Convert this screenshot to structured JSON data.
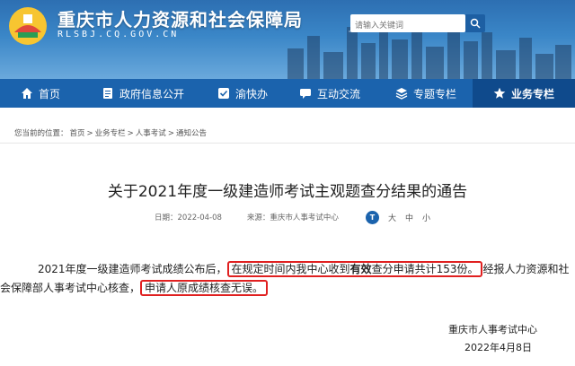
{
  "header": {
    "site_title": "重庆市人力资源和社会保障局",
    "site_domain": "RLSBJ.CQ.GOV.CN",
    "search_placeholder": "请输入关键词"
  },
  "nav": {
    "items": [
      {
        "label": "首页",
        "icon": "home-icon"
      },
      {
        "label": "政府信息公开",
        "icon": "document-icon"
      },
      {
        "label": "渝快办",
        "icon": "check-icon"
      },
      {
        "label": "互动交流",
        "icon": "chat-icon"
      },
      {
        "label": "专题专栏",
        "icon": "layers-icon"
      },
      {
        "label": "业务专栏",
        "icon": "star-icon",
        "active": true
      }
    ]
  },
  "breadcrumb": {
    "prefix": "您当前的位置：",
    "items": [
      "首页",
      "业务专栏",
      "人事考试",
      "通知公告"
    ],
    "separator": ">"
  },
  "article": {
    "title": "关于2021年度一级建造师考试主观题查分结果的通告",
    "date": "日期：2022-04-08",
    "source": "来源：重庆市人事考试中心",
    "font_sizes": [
      "大",
      "中",
      "小"
    ],
    "p1_before": "2021年度一级建造师考试成绩公布后，",
    "p1_box_a": "在规定时间内我中心收到",
    "p1_box_bold": "有效",
    "p1_box_b": "查分申请共计153份。",
    "p1_after": "经报人力资源和社",
    "p2_before": "会保障部人事考试中心核查，",
    "p2_box": "申请人原成绩核查无误。",
    "signature_org": "重庆市人事考试中心",
    "signature_date": "2022年4月8日"
  },
  "colors": {
    "nav_bg": "#1b63ad",
    "nav_active": "#0f4a8c",
    "highlight_border": "#e02020"
  }
}
